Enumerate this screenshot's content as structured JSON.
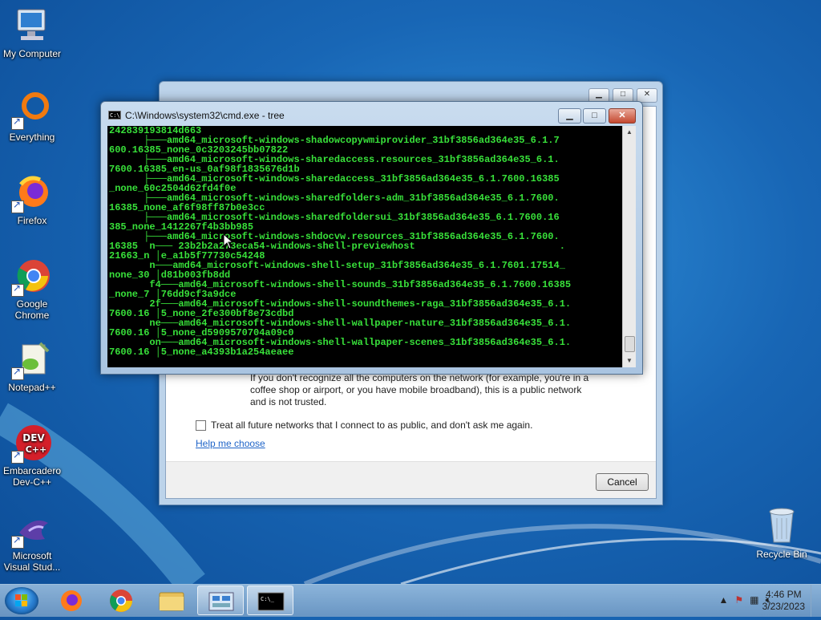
{
  "desktop": {
    "icons": [
      {
        "label": "My Computer"
      },
      {
        "label": "Everything"
      },
      {
        "label": "Firefox"
      },
      {
        "label": "Google Chrome"
      },
      {
        "label": "Notepad++"
      },
      {
        "label": "Embarcadero Dev-C++"
      },
      {
        "label": "Microsoft Visual Stud..."
      }
    ],
    "recycle_bin": {
      "label": "Recycle Bin"
    }
  },
  "dialog": {
    "body_text": "If you don't recognize all the computers on the network (for example, you're in a coffee shop or airport, or you have mobile broadband), this is a public network and is not trusted.",
    "checkbox_label": "Treat all future networks that I connect to as public, and don't ask me again.",
    "help_link": "Help me choose",
    "cancel_label": "Cancel"
  },
  "cmd": {
    "title": "C:\\Windows\\system32\\cmd.exe - tree",
    "lines": [
      "242839193814d663",
      "      ├───amd64_microsoft-windows-shadowcopywmiprovider_31bf3856ad364e35_6.1.7",
      "600.16385_none_0c3203245bb07822",
      "      ├───amd64_microsoft-windows-sharedaccess.resources_31bf3856ad364e35_6.1.",
      "7600.16385_en-us_0af98f1835676d1b",
      "      ├───amd64_microsoft-windows-sharedaccess_31bf3856ad364e35_6.1.7600.16385",
      "_none_60c2504d62fd4f0e",
      "      ├───amd64_microsoft-windows-sharedfolders-adm_31bf3856ad364e35_6.1.7600.",
      "16385_none_af6f98ff87b0e3cc",
      "      ├───amd64_microsoft-windows-sharedfoldersui_31bf3856ad364e35_6.1.7600.16",
      "385_none_1412267f4b3bb985",
      "      ├───amd64_microsoft-windows-shdocvw.resources_31bf3856ad364e35_6.1.7600.",
      "16385  n─── 23b2b2a273eca54-windows-shell-previewhost                         .",
      "21663_n │e_a1b5f77730c54248",
      "       n───amd64_microsoft-windows-shell-setup_31bf3856ad364e35_6.1.7601.17514_",
      "none_30 │d81b003fb8dd",
      "       f4───amd64_microsoft-windows-shell-sounds_31bf3856ad364e35_6.1.7600.16385",
      "_none_7 │76dd9cf3a9dce",
      "       2f───amd64_microsoft-windows-shell-soundthemes-raga_31bf3856ad364e35_6.1.",
      "7600.16 │5_none_2fe300bf8e73cdbd",
      "       ne───amd64_microsoft-windows-shell-wallpaper-nature_31bf3856ad364e35_6.1.",
      "7600.16 │5_none_d5909570704a09c0",
      "       on───amd64_microsoft-windows-shell-wallpaper-scenes_31bf3856ad364e35_6.1.",
      "7600.16 │5_none_a4393b1a254aeaee"
    ]
  },
  "taskbar": {
    "clock_time": "4:46 PM",
    "clock_date": "3/23/2023"
  }
}
